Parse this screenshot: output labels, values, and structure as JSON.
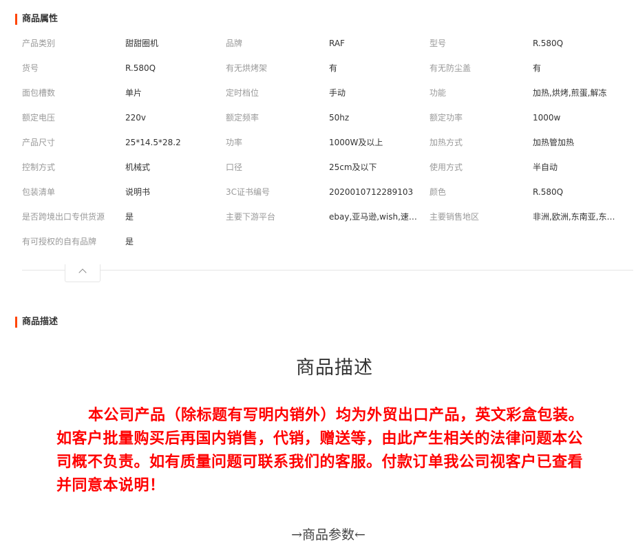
{
  "attributes_section": {
    "title": "商品属性",
    "rows": [
      [
        {
          "label": "产品类别",
          "value": "甜甜圈机"
        },
        {
          "label": "品牌",
          "value": "RAF"
        },
        {
          "label": "型号",
          "value": "R.580Q"
        }
      ],
      [
        {
          "label": "货号",
          "value": "R.580Q"
        },
        {
          "label": "有无烘烤架",
          "value": "有"
        },
        {
          "label": "有无防尘盖",
          "value": "有"
        }
      ],
      [
        {
          "label": "面包槽数",
          "value": "单片"
        },
        {
          "label": "定时档位",
          "value": "手动"
        },
        {
          "label": "功能",
          "value": "加热,烘烤,煎蛋,解冻"
        }
      ],
      [
        {
          "label": "额定电压",
          "value": "220v"
        },
        {
          "label": "额定频率",
          "value": "50hz"
        },
        {
          "label": "额定功率",
          "value": "1000w"
        }
      ],
      [
        {
          "label": "产品尺寸",
          "value": "25*14.5*28.2"
        },
        {
          "label": "功率",
          "value": "1000W及以上"
        },
        {
          "label": "加热方式",
          "value": "加热管加热"
        }
      ],
      [
        {
          "label": "控制方式",
          "value": "机械式"
        },
        {
          "label": "口径",
          "value": "25cm及以下"
        },
        {
          "label": "使用方式",
          "value": "半自动"
        }
      ],
      [
        {
          "label": "包装清单",
          "value": "说明书"
        },
        {
          "label": "3C证书编号",
          "value": "2020010712289103"
        },
        {
          "label": "颜色",
          "value": "R.580Q"
        }
      ],
      [
        {
          "label": "是否跨境出口专供货源",
          "value": "是"
        },
        {
          "label": "主要下游平台",
          "value": "ebay,亚马逊,wish,速…"
        },
        {
          "label": "主要销售地区",
          "value": "非洲,欧洲,东南亚,东…"
        }
      ],
      [
        {
          "label": "有可授权的自有品牌",
          "value": "是"
        }
      ]
    ]
  },
  "description_section": {
    "title": "商品描述",
    "heading": "商品描述",
    "notice": "本公司产品（除标题有写明内销外）均为外贸出口产品，英文彩盒包装。如客户批量购买后再国内销售，代销，赠送等，由此产生相关的法律问题本公司概不负责。如有质量问题可联系我们的客服。付款订单我公司视客户已查看并同意本说明！",
    "params_heading": "→商品参数←"
  },
  "colors": {
    "accent": "#ff4400",
    "notice": "#ff0000"
  }
}
